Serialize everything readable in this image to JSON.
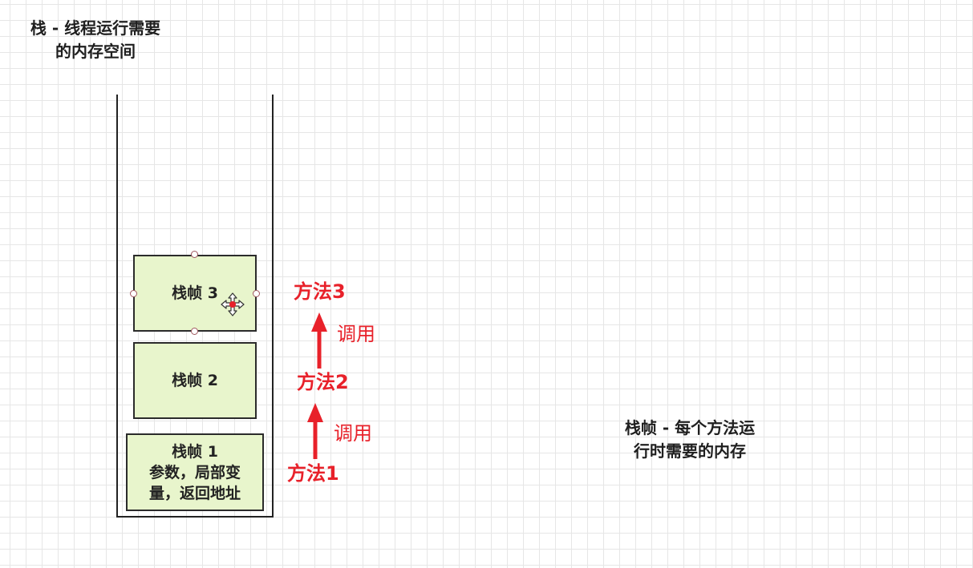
{
  "stack_title": [
    "栈 - 线程运行需要",
    "的内存空间"
  ],
  "frames": [
    {
      "name": "栈帧 3"
    },
    {
      "name": "栈帧 2"
    },
    {
      "name": "栈帧 1",
      "details": [
        "参数，局部变",
        "量，返回地址"
      ]
    }
  ],
  "methods": [
    "方法3",
    "方法2",
    "方法1"
  ],
  "call_label": "调用",
  "frame_description": [
    "栈帧 - 每个方法运",
    "行时需要的内存"
  ],
  "colors": {
    "frame_fill": "#e8f5cc",
    "accent_red": "#e8212a",
    "outline": "#222222"
  },
  "icons": {
    "selection": "move-cursor-icon",
    "call_direction": "arrow-up-icon"
  }
}
